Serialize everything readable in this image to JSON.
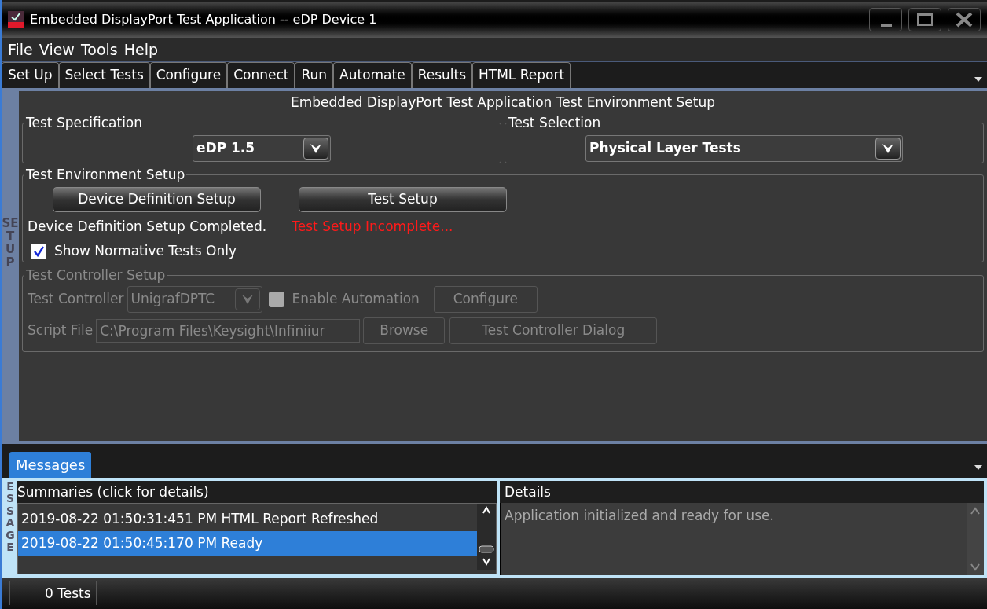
{
  "window": {
    "title": "Embedded DisplayPort Test Application -- eDP Device 1"
  },
  "menu": [
    "File",
    "View",
    "Tools",
    "Help"
  ],
  "tabs": [
    "Set Up",
    "Select Tests",
    "Configure",
    "Connect",
    "Run",
    "Automate",
    "Results",
    "HTML Report"
  ],
  "side_label": "SET UP",
  "setup": {
    "heading": "Embedded DisplayPort Test Application Test Environment Setup",
    "test_specification": {
      "label": "Test Specification",
      "value": "eDP 1.5"
    },
    "test_selection": {
      "label": "Test Selection",
      "value": "Physical Layer Tests"
    },
    "environment": {
      "label": "Test Environment Setup",
      "buttons": [
        "Device Definition Setup",
        "Test Setup"
      ],
      "statuses": [
        {
          "text": "Device Definition Setup Completed.",
          "kind": "ok"
        },
        {
          "text": "Test Setup Incomplete...",
          "kind": "error"
        }
      ],
      "checkbox": {
        "label": "Show Normative Tests Only",
        "checked": true
      }
    },
    "controller": {
      "label": "Test Controller Setup",
      "disabled": true,
      "controller_label": "Test Controller",
      "controller_value": "UnigrafDPTC",
      "automation": {
        "label": "Enable Automation",
        "checked": false
      },
      "configure_button": "Configure",
      "script_label": "Script File",
      "script_value": "C:\\Program Files\\Keysight\\Infiniiur",
      "browse_button": "Browse",
      "dialog_button": "Test Controller Dialog"
    }
  },
  "messages": {
    "tab": {
      "label": "Messages",
      "selected": true
    },
    "side_label": "ESSAGE",
    "summaries_header": "Summaries (click for details)",
    "rows": [
      {
        "text": "2019-08-22 01:50:31:451 PM HTML Report Refreshed",
        "selected": false
      },
      {
        "text": "2019-08-22 01:50:45:170 PM Ready",
        "selected": true
      }
    ],
    "details_header": "Details",
    "details": "Application initialized and ready for use."
  },
  "status_bar": {
    "count": "0 Tests"
  }
}
